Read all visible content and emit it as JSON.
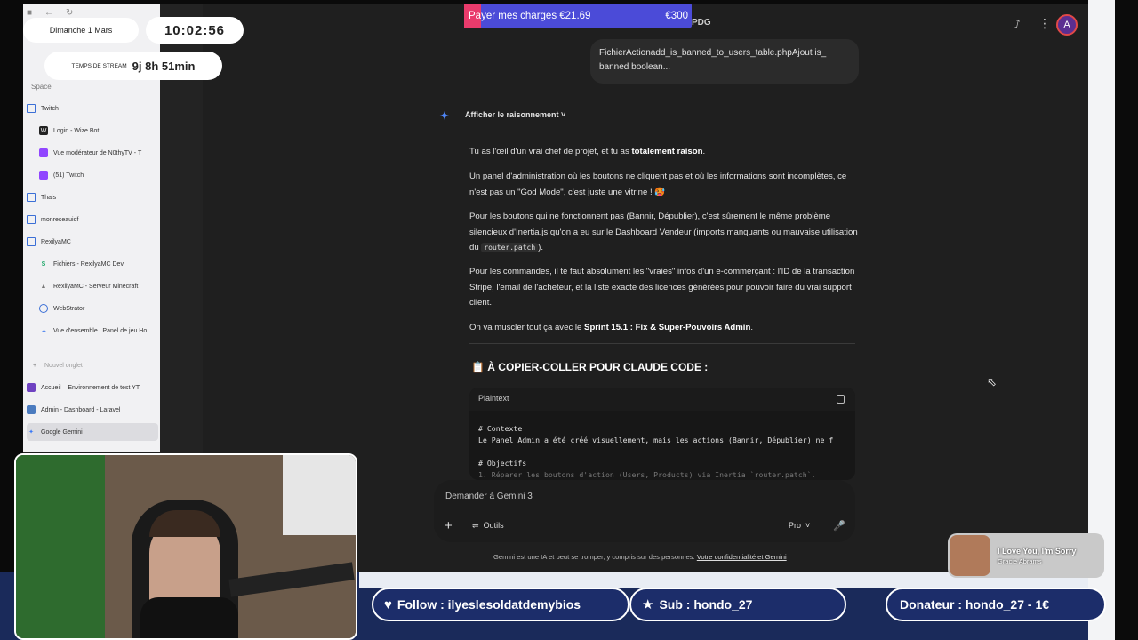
{
  "sidebar": {
    "space_label": "Space",
    "items": [
      {
        "label": "Twitch",
        "icon": "folder-icon"
      },
      {
        "label": "Login - Wize.Bot",
        "icon": "wizebot-icon"
      },
      {
        "label": "Vue modérateur de N0thyTV - T",
        "icon": "twitch-icon"
      },
      {
        "label": "(51) Twitch",
        "icon": "twitch-icon"
      },
      {
        "label": "Thais",
        "icon": "folder-icon"
      },
      {
        "label": "monreseauidf",
        "icon": "folder-icon"
      },
      {
        "label": "RexilyaMC",
        "icon": "folder-icon"
      },
      {
        "label": "Fichiers - RexilyaMC Dev",
        "icon": "s-icon"
      },
      {
        "label": "RexilyaMC - Serveur Minecraft",
        "icon": "minecraft-icon"
      },
      {
        "label": "WebStrator",
        "icon": "webstrator-icon"
      },
      {
        "label": "Vue d'ensemble | Panel de jeu Ho",
        "icon": "cloud-icon"
      },
      {
        "label": "Nouvel onglet",
        "icon": "plus-icon"
      },
      {
        "label": "Accueil – Environnement de test YT",
        "icon": "purple-icon"
      },
      {
        "label": "Admin - Dashboard - Laravel",
        "icon": "laravel-icon"
      },
      {
        "label": "Google Gemini",
        "icon": "gemini-icon"
      }
    ]
  },
  "header": {
    "title_fragment": "PDG",
    "avatar_letter": "A"
  },
  "chat": {
    "user_bubble": "FichierActionadd_is_banned_to_users_table.phpAjout is_ banned boolean...",
    "reasoning_toggle": "Afficher le raisonnement",
    "p1_pre": "Tu as l'œil d'un vrai chef de projet, et tu as ",
    "p1_bold": "totalement raison",
    "p1_post": ".",
    "p2": "Un panel d'administration où les boutons ne cliquent pas et où les informations sont incomplètes, ce n'est pas un \"God Mode\", c'est juste une vitrine ! 🥵",
    "p3_pre": "Pour les boutons qui ne fonctionnent pas (Bannir, Dépublier), c'est sûrement le même problème silencieux d'Inertia.js qu'on a eu sur le Dashboard Vendeur (imports manquants ou mauvaise utilisation du ",
    "p3_code": "router.patch",
    "p3_post": ").",
    "p4": "Pour les commandes, il te faut absolument les \"vraies\" infos d'un e-commerçant : l'ID de la transaction Stripe, l'email de l'acheteur, et la liste exacte des licences générées pour pouvoir faire du vrai support client.",
    "p5_pre": "On va muscler tout ça avec le ",
    "p5_bold": "Sprint 15.1 : Fix & Super-Pouvoirs Admin",
    "p5_post": ".",
    "copy_heading": "📋 À COPIER-COLLER POUR CLAUDE CODE :",
    "code_lang": "Plaintext",
    "code_line1": "# Contexte",
    "code_line2": "Le Panel Admin a été créé visuellement, mais les actions (Bannir, Dépublier) ne f",
    "code_line3": "# Objectifs",
    "code_line4": "1. Réparer les boutons d'action (Users, Products) via Inertia `router.patch`."
  },
  "composer": {
    "placeholder": "Demander à Gemini 3",
    "tools_label": "Outils",
    "model_label": "Pro",
    "disclaimer": "Gemini est une IA et peut se tromper, y compris sur des personnes.",
    "privacy_link": "Votre confidentialité et Gemini"
  },
  "overlay": {
    "date": "Dimanche 1 Mars",
    "time": "10:02:56",
    "stream_label": "TEMPS DE STREAM",
    "stream_value": "9j 8h 51min",
    "goal_label": "Payer mes charges €21.69",
    "goal_target": "€300",
    "goal_progress": 0.0723,
    "music_song": "I Love You, I'm Sorry",
    "music_artist": "Gracie Abrams",
    "follow": "Follow : ilyeslesoldatdemybios",
    "sub": "Sub : hondo_27",
    "donor": "Donateur : hondo_27 - 1€"
  },
  "colors": {
    "accent_gemini": "#4f86f7",
    "goal_bar": "#4b4bd8",
    "goal_fill": "#e93b6c",
    "alert_bg": "#1c2d6a"
  }
}
